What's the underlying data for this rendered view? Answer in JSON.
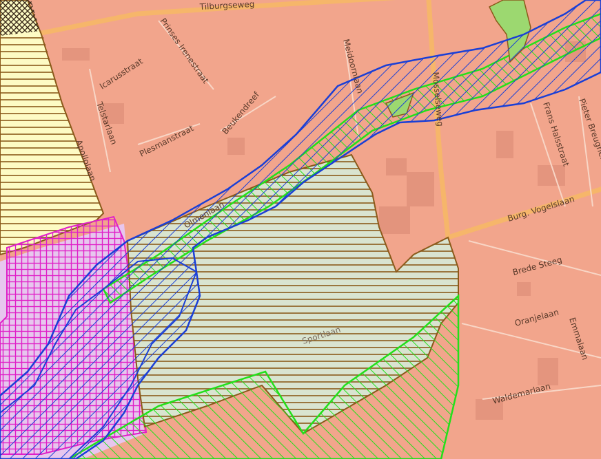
{
  "map": {
    "streets": [
      {
        "id": "tilburgseweg",
        "name": "Tilburgseweg"
      },
      {
        "id": "prinses-irenestraat",
        "name": "Prinses Irenestraat"
      },
      {
        "id": "icarusstraat",
        "name": "Icarusstraat"
      },
      {
        "id": "telstarlaan",
        "name": "Telstarlaan"
      },
      {
        "id": "apollolaan",
        "name": "Apollolaan"
      },
      {
        "id": "plesmanstraat",
        "name": "Plesmanstraat"
      },
      {
        "id": "beukendreef",
        "name": "Beukendreef"
      },
      {
        "id": "meidoornlaan",
        "name": "Meidoornlaan"
      },
      {
        "id": "mosselseweg",
        "name": "Mosselseweg"
      },
      {
        "id": "olmenlaan",
        "name": "Olmenlaan"
      },
      {
        "id": "frans-halsstraat",
        "name": "Frans Halsstraat"
      },
      {
        "id": "pieter-breughelstraat",
        "name": "Pieter Breughelstraat"
      },
      {
        "id": "burg-vogelslaan",
        "name": "Burg. Vogelslaan"
      },
      {
        "id": "brede-steeg",
        "name": "Brede Steeg"
      },
      {
        "id": "oranjelaan",
        "name": "Oranjelaan"
      },
      {
        "id": "emmalaan",
        "name": "Emmalaan"
      },
      {
        "id": "waldemarlaan",
        "name": "Waldemarlaan"
      },
      {
        "id": "sportlaan",
        "name": "Sportlaan"
      }
    ],
    "colors": {
      "urban": "#f2a58c",
      "sports_area": "#d9e4d0",
      "sports_hatch": "#8a5a1a",
      "yellow_zone": "#fdfbc4",
      "purple_zone": "#e7c6ee",
      "magenta_hatch": "#e020c8",
      "blue_corridor": "#1a3fd6",
      "green_zone": "#22e01a",
      "green_fill": "#9cd870",
      "road": "#f6b66a"
    }
  }
}
